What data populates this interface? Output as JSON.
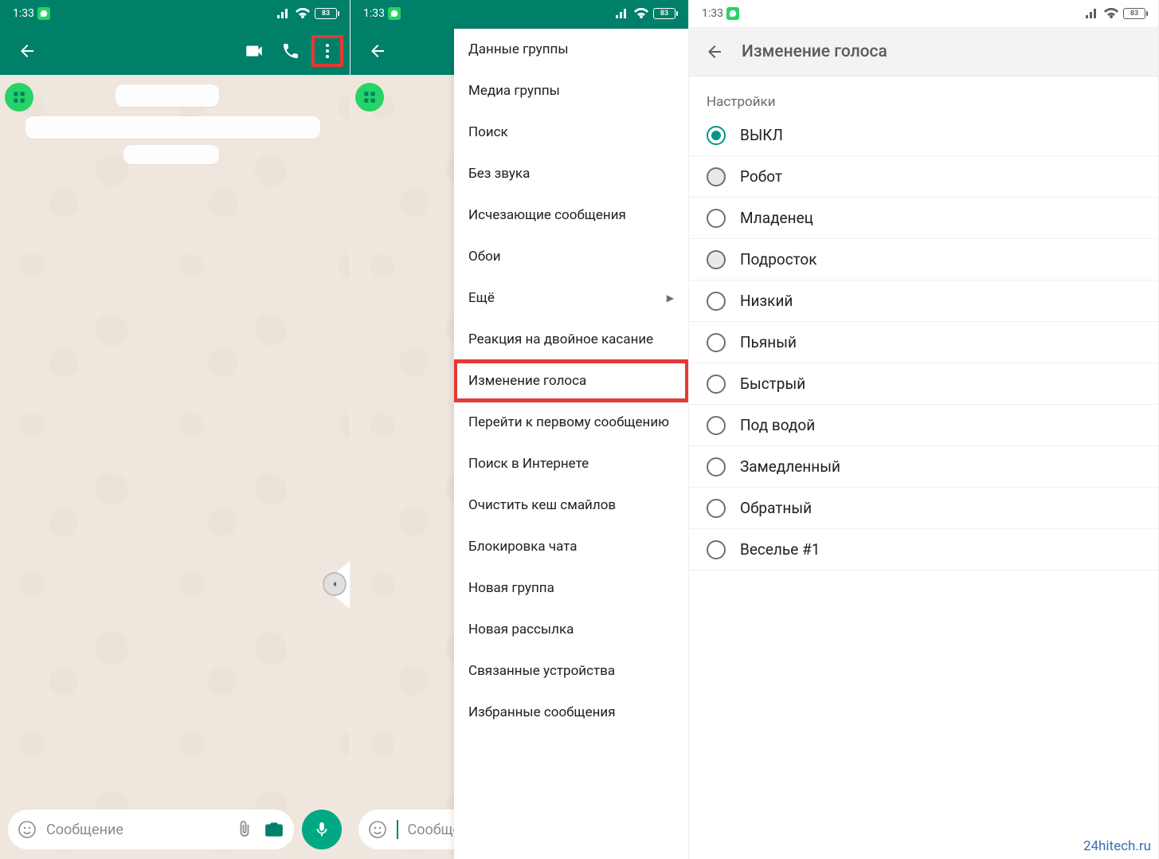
{
  "status": {
    "time": "1:33",
    "battery": "83"
  },
  "chat": {
    "placeholder": "Сообщение"
  },
  "menu": {
    "items": [
      {
        "label": "Данные группы",
        "highlighted": false
      },
      {
        "label": "Медиа группы",
        "highlighted": false
      },
      {
        "label": "Поиск",
        "highlighted": false
      },
      {
        "label": "Без звука",
        "highlighted": false
      },
      {
        "label": "Исчезающие сообщения",
        "highlighted": false
      },
      {
        "label": "Обои",
        "highlighted": false
      },
      {
        "label": "Ещё",
        "submenu": true,
        "highlighted": false
      },
      {
        "label": "Реакция на двойное касание",
        "highlighted": false
      },
      {
        "label": "Изменение голоса",
        "highlighted": true
      },
      {
        "label": "Перейти к первому сообщению",
        "highlighted": false
      },
      {
        "label": "Поиск в Интернете",
        "highlighted": false
      },
      {
        "label": "Очистить кеш смайлов",
        "highlighted": false
      },
      {
        "label": "Блокировка чата",
        "highlighted": false
      },
      {
        "label": "Новая группа",
        "highlighted": false
      },
      {
        "label": "Новая рассылка",
        "highlighted": false
      },
      {
        "label": "Связанные устройства",
        "highlighted": false
      },
      {
        "label": "Избранные сообщения",
        "highlighted": false
      }
    ]
  },
  "settings": {
    "title": "Изменение голоса",
    "section": "Настройки",
    "options": [
      {
        "label": "ВЫКЛ",
        "selected": true
      },
      {
        "label": "Робот",
        "selected": false,
        "bg": true
      },
      {
        "label": "Младенец",
        "selected": false
      },
      {
        "label": "Подросток",
        "selected": false,
        "bg": true
      },
      {
        "label": "Низкий",
        "selected": false
      },
      {
        "label": "Пьяный",
        "selected": false
      },
      {
        "label": "Быстрый",
        "selected": false
      },
      {
        "label": "Под водой",
        "selected": false
      },
      {
        "label": "Замедленный",
        "selected": false
      },
      {
        "label": "Обратный",
        "selected": false
      },
      {
        "label": "Веселье #1",
        "selected": false
      }
    ]
  },
  "watermark": "24hitech.ru"
}
